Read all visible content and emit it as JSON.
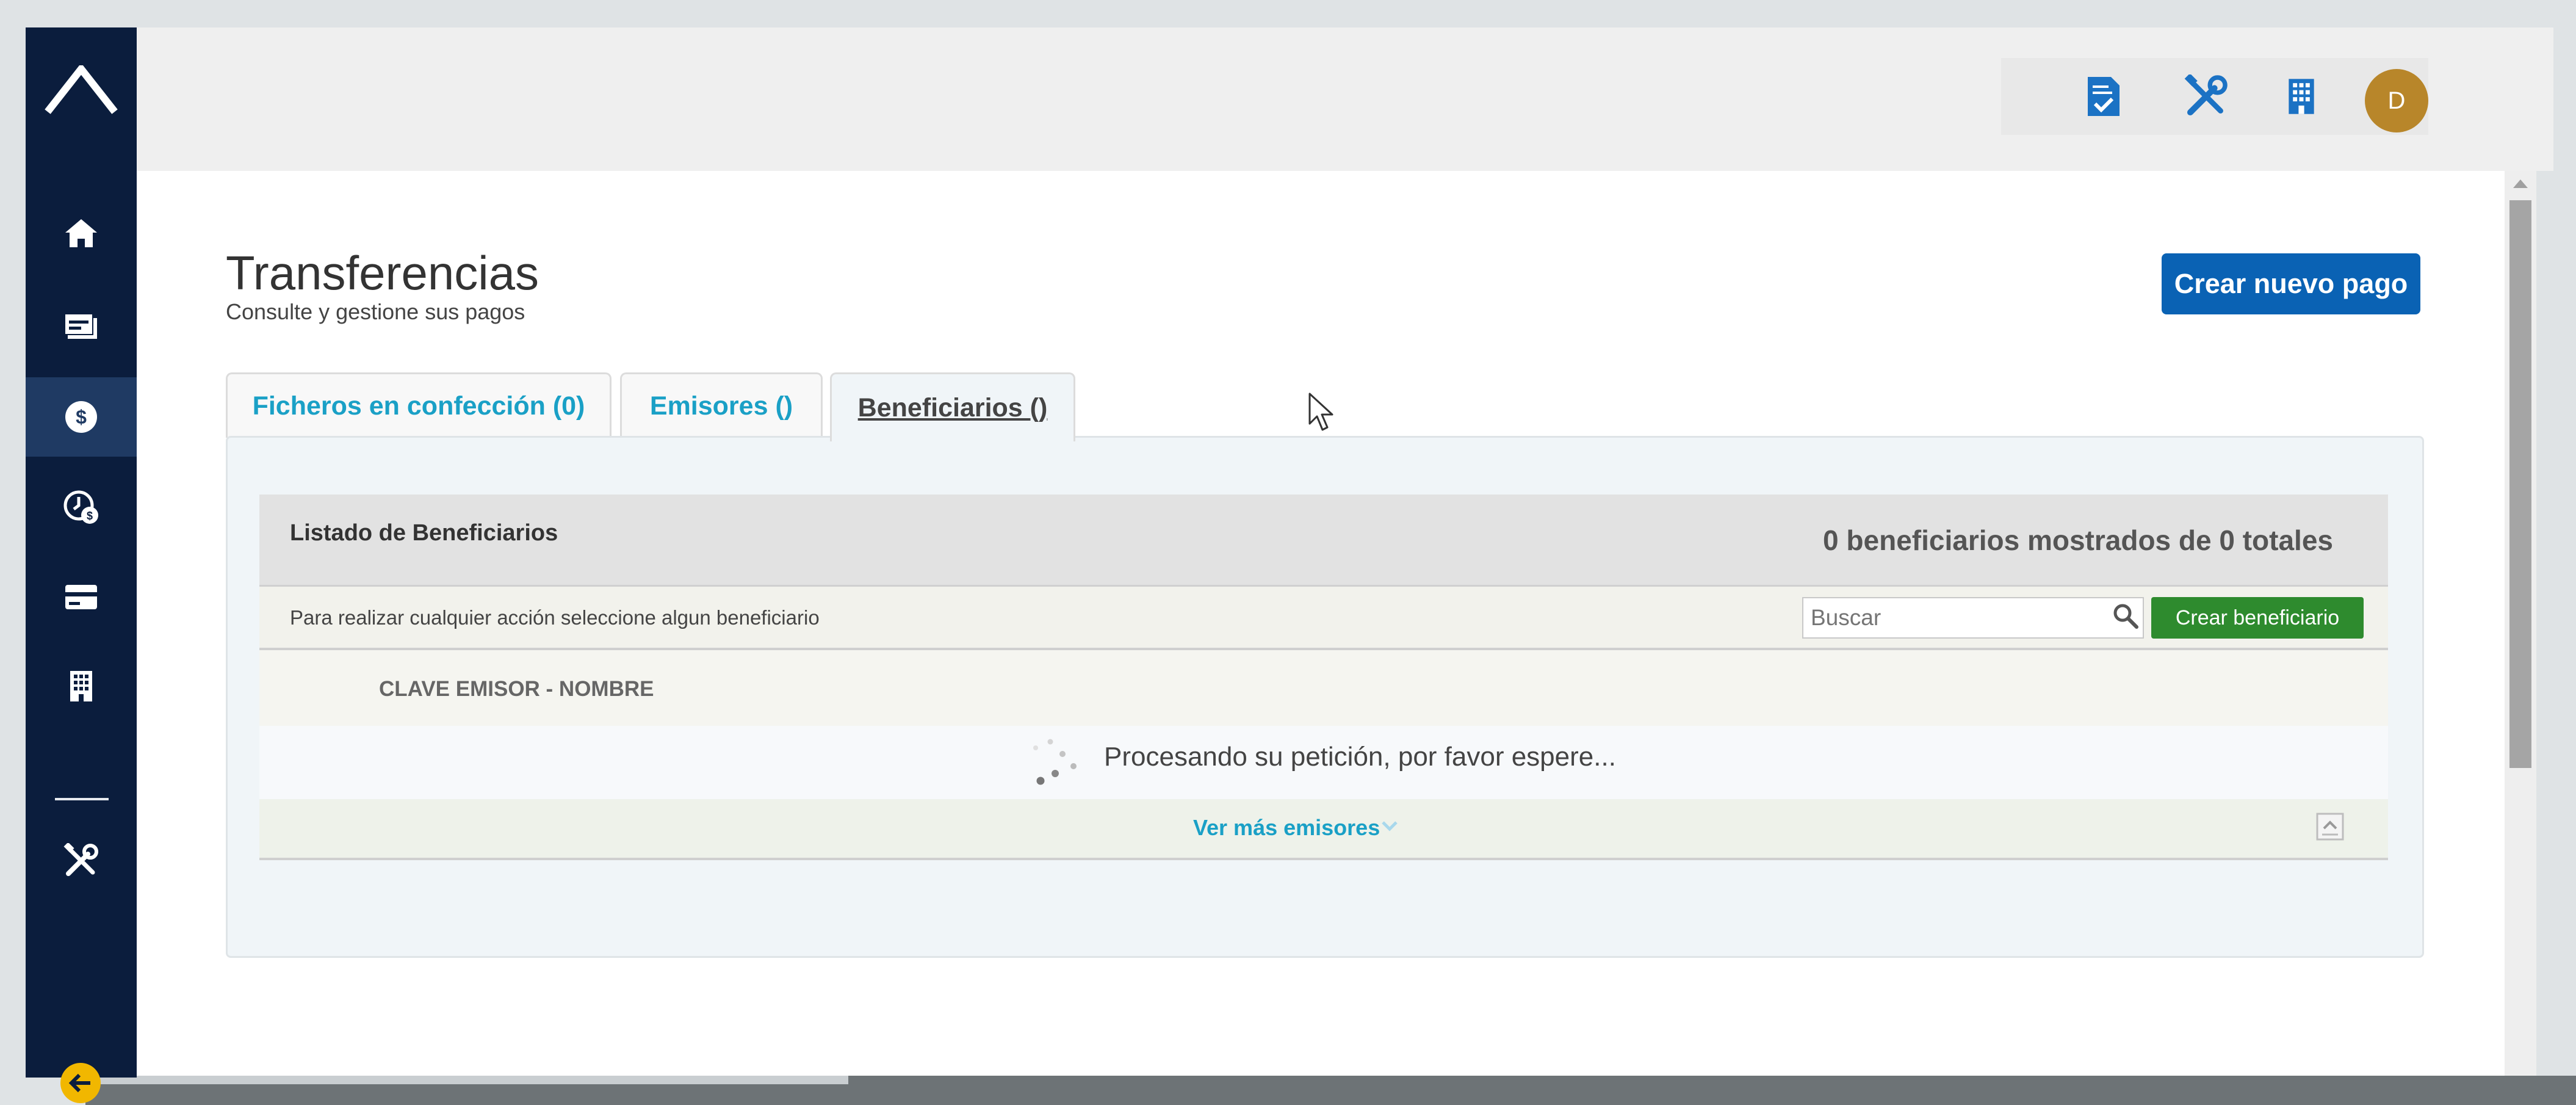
{
  "colors": {
    "sidebar_bg": "#0b1d3d",
    "sidebar_active": "#1f3a63",
    "primary": "#0a62b4",
    "link": "#1aa0c6",
    "green": "#2e8b2e",
    "avatar": "#b8862a",
    "collapse": "#f1b700"
  },
  "sidebar": {
    "logo": "logo-caret-icon",
    "items": [
      {
        "icon": "home-icon"
      },
      {
        "icon": "accounts-icon"
      },
      {
        "icon": "dollar-icon",
        "active": true
      },
      {
        "icon": "clock-dollar-icon"
      },
      {
        "icon": "card-icon"
      },
      {
        "icon": "building-icon"
      },
      {
        "icon": "tools-icon"
      }
    ],
    "collapse_icon": "arrow-left-icon"
  },
  "topbar": {
    "icons": [
      "document-check-icon",
      "tools-icon",
      "building-icon"
    ],
    "avatar_initial": "D"
  },
  "page": {
    "title": "Transferencias",
    "subtitle": "Consulte y gestione sus pagos",
    "create_payment_button": "Crear nuevo pago"
  },
  "tabs": [
    {
      "label": "Ficheros en confección (0)",
      "active": false
    },
    {
      "label": "Emisores ()",
      "active": false
    },
    {
      "label": "Beneficiarios ()",
      "active": true
    }
  ],
  "list": {
    "title": "Listado de Beneficiarios",
    "count_text": "0 beneficiarios mostrados de 0 totales",
    "hint": "Para realizar cualquier acción seleccione algun beneficiario",
    "search_placeholder": "Buscar",
    "create_button": "Crear beneficiario",
    "column_header": "CLAVE EMISOR - NOMBRE",
    "loading_text": "Procesando su petición, por favor espere...",
    "more_link": "Ver más emisores"
  }
}
